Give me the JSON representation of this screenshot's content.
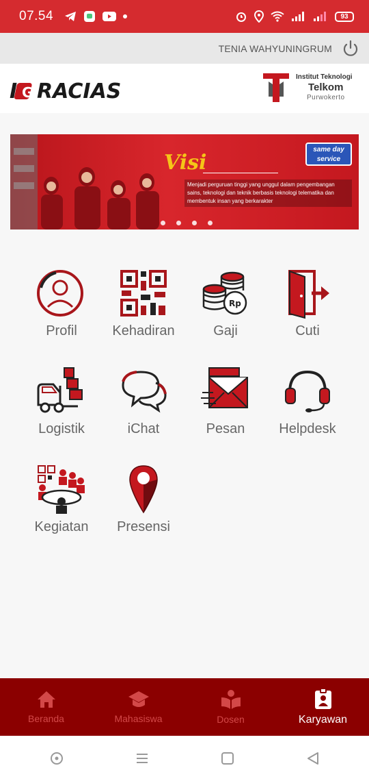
{
  "status_bar": {
    "time": "07.54",
    "battery": "93"
  },
  "user": {
    "name": "TENIA WAHYUNINGRUM"
  },
  "header": {
    "app_logo_text": "iGRACIAS",
    "institution_line1": "Institut Teknologi",
    "institution_line2": "Telkom",
    "institution_line3": "Purwokerto"
  },
  "banner": {
    "title": "Visi",
    "text": "Menjadi perguruan tinggi yang unggul dalam pengembangan sains, teknologi dan teknik berbasis teknologi telematika dan membentuk insan yang berkarakter",
    "badge": "same day service"
  },
  "menu": {
    "items": [
      {
        "label": "Profil",
        "icon": "user-circle-icon"
      },
      {
        "label": "Kehadiran",
        "icon": "qr-code-icon"
      },
      {
        "label": "Gaji",
        "icon": "coins-icon"
      },
      {
        "label": "Cuti",
        "icon": "exit-door-icon"
      },
      {
        "label": "Logistik",
        "icon": "truck-boxes-icon"
      },
      {
        "label": "iChat",
        "icon": "chat-bubbles-icon"
      },
      {
        "label": "Pesan",
        "icon": "envelope-icon"
      },
      {
        "label": "Helpdesk",
        "icon": "headset-icon"
      },
      {
        "label": "Kegiatan",
        "icon": "meeting-icon"
      },
      {
        "label": "Presensi",
        "icon": "map-pin-icon"
      }
    ]
  },
  "bottom_nav": {
    "items": [
      {
        "label": "Beranda",
        "icon": "home-icon"
      },
      {
        "label": "Mahasiswa",
        "icon": "graduation-cap-icon"
      },
      {
        "label": "Dosen",
        "icon": "book-reader-icon"
      },
      {
        "label": "Karyawan",
        "icon": "id-badge-icon"
      }
    ],
    "active": "Karyawan"
  },
  "colors": {
    "status_bar": "#d52b2f",
    "brand_red": "#c4181f",
    "bottom_nav": "#8b0000"
  }
}
